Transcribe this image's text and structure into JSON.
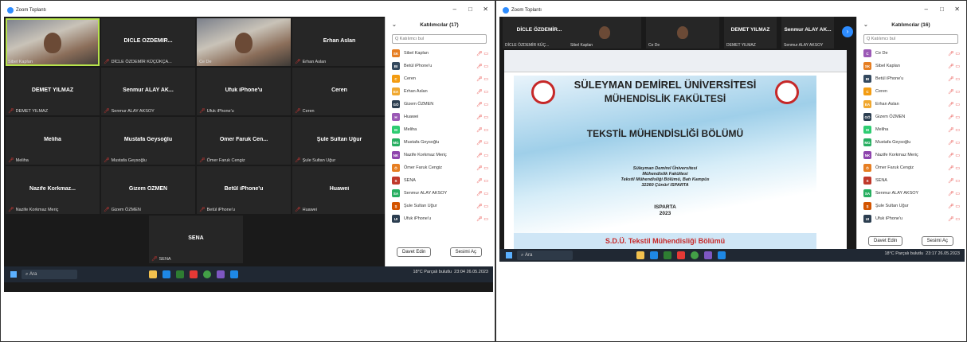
{
  "left": {
    "window_title": "Zoom Toplantı",
    "tiles": [
      {
        "name": "",
        "label": "Sibel Kaplan",
        "camera": true,
        "active": true
      },
      {
        "name": "DİCLE ÖZDEMİR...",
        "label": "DİCLE ÖZDEMİR KÜÇÜKÇA...",
        "camera": false
      },
      {
        "name": "",
        "label": "Ce De",
        "camera": true
      },
      {
        "name": "Erhan Aslan",
        "label": "Erhan Aslan",
        "camera": false
      },
      {
        "name": "DEMET YILMAZ",
        "label": "DEMET YILMAZ",
        "camera": false
      },
      {
        "name": "Senmur ALAY AK...",
        "label": "Senmur ALAY AKSOY",
        "camera": false
      },
      {
        "name": "Ufuk iPhone'u",
        "label": "Ufuk iPhone'u",
        "camera": false
      },
      {
        "name": "Ceren",
        "label": "Ceren",
        "camera": false
      },
      {
        "name": "Meliha",
        "label": "Meliha",
        "camera": false
      },
      {
        "name": "Mustafa Geysoğlu",
        "label": "Mustafa Geysoğlu",
        "camera": false
      },
      {
        "name": "Ömer Faruk Cen...",
        "label": "Ömer Faruk Cengiz",
        "camera": false
      },
      {
        "name": "Şule Sultan Uğur",
        "label": "Şule Sultan Uğur",
        "camera": false
      },
      {
        "name": "Nazife Korkmaz...",
        "label": "Nazife Korkmaz Meriç",
        "camera": false
      },
      {
        "name": "Gizem ÖZMEN",
        "label": "Gizem ÖZMEN",
        "camera": false
      },
      {
        "name": "Betül iPhone'u",
        "label": "Betül iPhone'u",
        "camera": false
      },
      {
        "name": "Huawei",
        "label": "Huawei",
        "camera": false
      },
      {
        "name": "SENA",
        "label": "SENA",
        "camera": false
      }
    ],
    "panel": {
      "title": "Katılımcılar (17)",
      "search_placeholder": "Q Katılımcı bul",
      "participants": [
        {
          "initials": "SK",
          "name": "Sibel Kaplan",
          "color": "#e67e22"
        },
        {
          "initials": "BI",
          "name": "Betül iPhone'u",
          "color": "#34495e"
        },
        {
          "initials": "C",
          "name": "Ceren",
          "color": "#f39c12"
        },
        {
          "initials": "EA",
          "name": "Erhan Aslan",
          "color": "#f0a830"
        },
        {
          "initials": "GÖ",
          "name": "Gizem ÖZMEN",
          "color": "#2c3e50"
        },
        {
          "initials": "H",
          "name": "Huawei",
          "color": "#9b59b6"
        },
        {
          "initials": "M",
          "name": "Meliha",
          "color": "#2ecc71"
        },
        {
          "initials": "MG",
          "name": "Mustafa Geysoğlu",
          "color": "#27ae60"
        },
        {
          "initials": "NK",
          "name": "Nazife Korkmaz Meriç",
          "color": "#8e44ad"
        },
        {
          "initials": "Ö",
          "name": "Ömer Faruk Cengiz",
          "color": "#e67e22"
        },
        {
          "initials": "S",
          "name": "SENA",
          "color": "#c0392b"
        },
        {
          "initials": "SA",
          "name": "Senmur ALAY AKSOY",
          "color": "#27ae60"
        },
        {
          "initials": "Ş",
          "name": "Şule Sultan Uğur",
          "color": "#d35400"
        },
        {
          "initials": "UI",
          "name": "Ufuk iPhone'u",
          "color": "#2c3e50"
        }
      ],
      "invite_button": "Davet Edin",
      "unmute_button": "Sesimi Aç"
    },
    "taskbar": {
      "search": "Ara",
      "weather": "18°C Parçalı bulutlu",
      "time": "23:04",
      "date": "26.05.2023"
    }
  },
  "right": {
    "window_title": "Zoom Toplantı",
    "strip": [
      {
        "name": "DİCLE ÖZDEMİR...",
        "label": "DİCLE ÖZDEMİR KÜÇ...",
        "camera": false
      },
      {
        "name": "",
        "label": "Sibel Kaplan",
        "camera": true
      },
      {
        "name": "",
        "label": "Ce De",
        "camera": true
      },
      {
        "name": "DEMET YILMAZ",
        "label": "DEMET YILMAZ",
        "camera": false
      },
      {
        "name": "Senmur ALAY AK...",
        "label": "Senmur ALAY AKSOY",
        "camera": false
      }
    ],
    "slide": {
      "university": "SÜLEYMAN DEMİREL ÜNİVERSİTESİ",
      "faculty": "MÜHENDİSLİK FAKÜLTESİ",
      "department": "TEKSTİL MÜHENDİSLİĞİ BÖLÜMÜ",
      "address_lines": [
        "Süleyman Demirel Üniversitesi",
        "Mühendislik Fakültesi",
        "Tekstil Mühendisliği Bölümü, Batı Kampüs",
        "32260 Çünür/ ISPARTA"
      ],
      "city": "ISPARTA",
      "year": "2023",
      "footer": "S.D.Ü. Tekstil Mühendisliği Bölümü"
    },
    "panel": {
      "title": "Katılımcılar (16)",
      "search_placeholder": "Q Katılımcı bul",
      "participants": [
        {
          "initials": "C",
          "name": "Ce De",
          "color": "#9b59b6"
        },
        {
          "initials": "SK",
          "name": "Sibel Kaplan",
          "color": "#e67e22"
        },
        {
          "initials": "BI",
          "name": "Betül iPhone'u",
          "color": "#34495e"
        },
        {
          "initials": "C",
          "name": "Ceren",
          "color": "#f39c12"
        },
        {
          "initials": "EA",
          "name": "Erhan Aslan",
          "color": "#f0a830"
        },
        {
          "initials": "GÖ",
          "name": "Gizem ÖZMEN",
          "color": "#2c3e50"
        },
        {
          "initials": "M",
          "name": "Meliha",
          "color": "#2ecc71"
        },
        {
          "initials": "MG",
          "name": "Mustafa Geysoğlu",
          "color": "#27ae60"
        },
        {
          "initials": "NK",
          "name": "Nazife Korkmaz Meriç",
          "color": "#8e44ad"
        },
        {
          "initials": "Ö",
          "name": "Ömer Faruk Cengiz",
          "color": "#e67e22"
        },
        {
          "initials": "S",
          "name": "SENA",
          "color": "#c0392b"
        },
        {
          "initials": "SA",
          "name": "Senmur ALAY AKSOY",
          "color": "#27ae60"
        },
        {
          "initials": "Ş",
          "name": "Şule Sultan Uğur",
          "color": "#d35400"
        },
        {
          "initials": "UI",
          "name": "Ufuk iPhone'u",
          "color": "#2c3e50"
        }
      ],
      "invite_button": "Davet Edin",
      "unmute_button": "Sesimi Aç"
    },
    "taskbar": {
      "search": "Ara",
      "weather": "18°C Parçalı bulutlu",
      "time": "23:17",
      "date": "26.05.2023"
    }
  }
}
